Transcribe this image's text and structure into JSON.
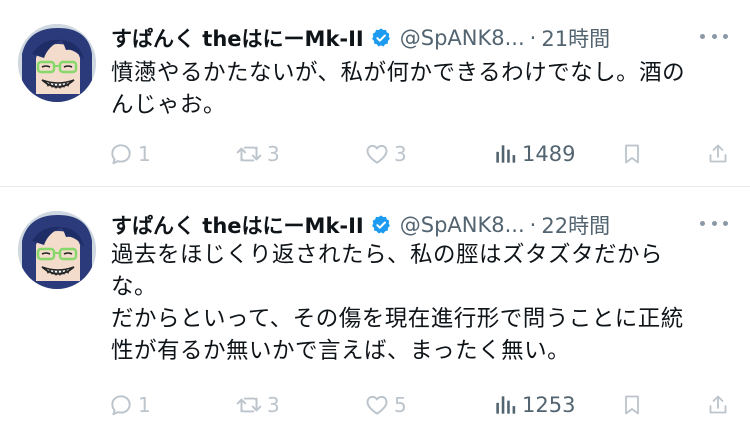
{
  "tweets": [
    {
      "display_name": "すぱんく theはにーMk-II",
      "handle": "@SpANK8...",
      "separator": "·",
      "time": "21時間",
      "text_lines": [
        "憤懣やるかたないが、私が何かできるわけでなし。酒の",
        "んじゃお。"
      ],
      "replies": "1",
      "retweets": "3",
      "likes": "3",
      "views": "1489"
    },
    {
      "display_name": "すぱんく theはにーMk-II",
      "handle": "@SpANK8...",
      "separator": "·",
      "time": "22時間",
      "text_lines": [
        "過去をほじくり返されたら、私の脛はズタズタだから",
        "な。",
        "だからといって、その傷を現在進行形で問うことに正統",
        "性が有るか無いかで言えば、まったく無い。"
      ],
      "replies": "1",
      "retweets": "3",
      "likes": "5",
      "views": "1253"
    }
  ],
  "colors": {
    "verified": "#1d9bf0",
    "muted_text": "#536471",
    "action_icon": "#bcc4cc",
    "divider": "#e6ecf0"
  },
  "icons": {
    "verified": "verified-badge-icon",
    "more": "more-dots-icon",
    "reply": "reply-bubble-icon",
    "retweet": "retweet-icon",
    "like": "heart-icon",
    "views": "bar-chart-icon",
    "bookmark": "bookmark-icon",
    "share": "share-icon"
  }
}
